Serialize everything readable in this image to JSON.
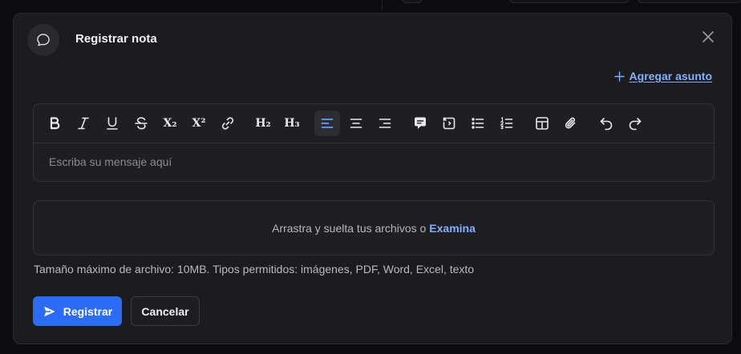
{
  "dialog": {
    "title": "Registrar nota",
    "header_icon": "chat-bubble-icon",
    "close_icon": "close-icon"
  },
  "add_subject": {
    "icon": "plus-icon",
    "label": "Agregar asunto"
  },
  "toolbar": {
    "h2_label": "H₂",
    "h3_label": "H₃",
    "subscript_label": "X₂",
    "superscript_label": "X²",
    "active_tool": "align-left"
  },
  "editor": {
    "placeholder": "Escriba su mensaje aquí"
  },
  "dropzone": {
    "text": "Arrastra y suelta tus archivos o",
    "browse_label": "Examina"
  },
  "hint": "Tamaño máximo de archivo: 10MB. Tipos permitidos: imágenes, PDF, Word, Excel, texto",
  "actions": {
    "submit_label": "Registrar",
    "submit_icon": "send-icon",
    "cancel_label": "Cancelar"
  },
  "colors": {
    "accent": "#2b6cf6",
    "link": "#7fb0ff",
    "surface": "#1c1c1f"
  }
}
